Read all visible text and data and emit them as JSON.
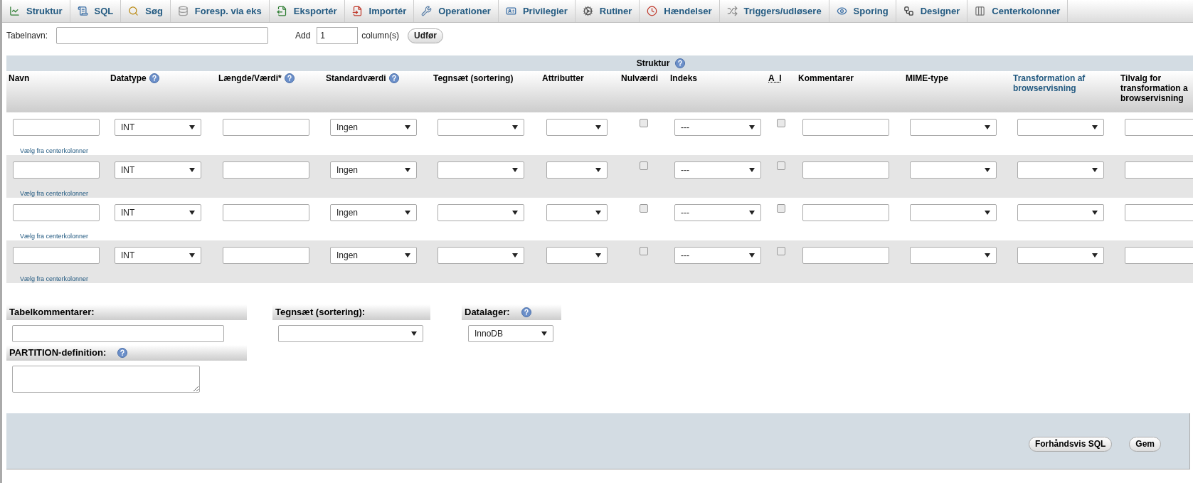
{
  "tabs": [
    {
      "label": "Struktur"
    },
    {
      "label": "SQL"
    },
    {
      "label": "Søg"
    },
    {
      "label": "Foresp. via eks"
    },
    {
      "label": "Eksportér"
    },
    {
      "label": "Importér"
    },
    {
      "label": "Operationer"
    },
    {
      "label": "Privilegier"
    },
    {
      "label": "Rutiner"
    },
    {
      "label": "Hændelser"
    },
    {
      "label": "Triggers/udløsere"
    },
    {
      "label": "Sporing"
    },
    {
      "label": "Designer"
    },
    {
      "label": "Centerkolonner"
    }
  ],
  "table_name": {
    "label": "Tabelnavn:"
  },
  "add_columns": {
    "label": "Add",
    "value": "1",
    "unit": "column(s)",
    "button": "Udfør"
  },
  "structure_table": {
    "title": "Struktur",
    "title_help": true,
    "columns": [
      {
        "label": "Navn",
        "kind": "plain"
      },
      {
        "label": "Datatype",
        "help": true,
        "kind": "plain"
      },
      {
        "label": "Længde/Værdi*",
        "help": true,
        "kind": "plain"
      },
      {
        "label": "Standardværdi",
        "help": true,
        "kind": "plain"
      },
      {
        "label": "Tegnsæt (sortering)",
        "kind": "plain"
      },
      {
        "label": "Attributter",
        "kind": "plain"
      },
      {
        "label": "Nulværdi",
        "kind": "plain"
      },
      {
        "label": "Indeks",
        "kind": "plain"
      },
      {
        "label": "A_I",
        "kind": "abbr"
      },
      {
        "label": "Kommentarer",
        "kind": "plain"
      },
      {
        "label": "MIME-type",
        "kind": "plain"
      },
      {
        "label": "Transformation af browservisning",
        "kind": "link"
      },
      {
        "label": "Tilvalg for transformation a browservisning",
        "kind": "plain"
      }
    ],
    "rows": [
      {
        "link": "Vælg fra centerkolonner",
        "cells": [
          {
            "kind": "input"
          },
          {
            "kind": "select",
            "value": "INT"
          },
          {
            "kind": "input"
          },
          {
            "kind": "select",
            "value": "Ingen"
          },
          {
            "kind": "select"
          },
          {
            "kind": "select"
          },
          {
            "kind": "checkbox",
            "checked": false
          },
          {
            "kind": "select",
            "value": "---"
          },
          {
            "kind": "checkbox",
            "checked": false
          },
          {
            "kind": "input"
          },
          {
            "kind": "select"
          },
          {
            "kind": "select"
          },
          {
            "kind": "input"
          }
        ]
      },
      {
        "link": "Vælg fra centerkolonner",
        "cells": [
          {
            "kind": "input"
          },
          {
            "kind": "select",
            "value": "INT"
          },
          {
            "kind": "input"
          },
          {
            "kind": "select",
            "value": "Ingen"
          },
          {
            "kind": "select"
          },
          {
            "kind": "select"
          },
          {
            "kind": "checkbox",
            "checked": false
          },
          {
            "kind": "select",
            "value": "---"
          },
          {
            "kind": "checkbox",
            "checked": false
          },
          {
            "kind": "input"
          },
          {
            "kind": "select"
          },
          {
            "kind": "select"
          },
          {
            "kind": "input"
          }
        ]
      },
      {
        "link": "Vælg fra centerkolonner",
        "cells": [
          {
            "kind": "input"
          },
          {
            "kind": "select",
            "value": "INT"
          },
          {
            "kind": "input"
          },
          {
            "kind": "select",
            "value": "Ingen"
          },
          {
            "kind": "select"
          },
          {
            "kind": "select"
          },
          {
            "kind": "checkbox",
            "checked": false
          },
          {
            "kind": "select",
            "value": "---"
          },
          {
            "kind": "checkbox",
            "checked": false
          },
          {
            "kind": "input"
          },
          {
            "kind": "select"
          },
          {
            "kind": "select"
          },
          {
            "kind": "input"
          }
        ]
      },
      {
        "link": "Vælg fra centerkolonner",
        "cells": [
          {
            "kind": "input"
          },
          {
            "kind": "select",
            "value": "INT"
          },
          {
            "kind": "input"
          },
          {
            "kind": "select",
            "value": "Ingen"
          },
          {
            "kind": "select"
          },
          {
            "kind": "select"
          },
          {
            "kind": "checkbox",
            "checked": false
          },
          {
            "kind": "select",
            "value": "---"
          },
          {
            "kind": "checkbox",
            "checked": false
          },
          {
            "kind": "input"
          },
          {
            "kind": "select"
          },
          {
            "kind": "select"
          },
          {
            "kind": "input"
          }
        ]
      }
    ]
  },
  "table_comments": {
    "label": "Tabelkommentarer:"
  },
  "collation": {
    "label": "Tegnsæt (sortering):"
  },
  "storage_engine": {
    "label": "Datalager:",
    "help": true,
    "value": "InnoDB"
  },
  "partition": {
    "label": "PARTITION-definition:",
    "help": true
  },
  "buttons": [
    "Forhåndsvis SQL",
    "Gem"
  ]
}
